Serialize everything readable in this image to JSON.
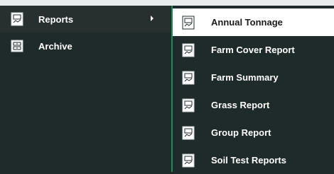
{
  "menu": {
    "items": [
      {
        "label": "Reports",
        "icon": "report-icon",
        "has_submenu": true
      },
      {
        "label": "Archive",
        "icon": "archive-icon"
      }
    ]
  },
  "submenu": {
    "items": [
      {
        "label": "Annual Tonnage",
        "icon": "report-icon"
      },
      {
        "label": "Farm Cover Report",
        "icon": "report-icon"
      },
      {
        "label": "Farm Summary",
        "icon": "report-icon"
      },
      {
        "label": "Grass Report",
        "icon": "report-icon"
      },
      {
        "label": "Group Report",
        "icon": "report-icon"
      },
      {
        "label": "Soil Test Reports",
        "icon": "report-icon"
      }
    ]
  },
  "colors": {
    "background": "#1f2a2a",
    "accent": "#1d8a5c",
    "highlight": "#ffffff"
  }
}
